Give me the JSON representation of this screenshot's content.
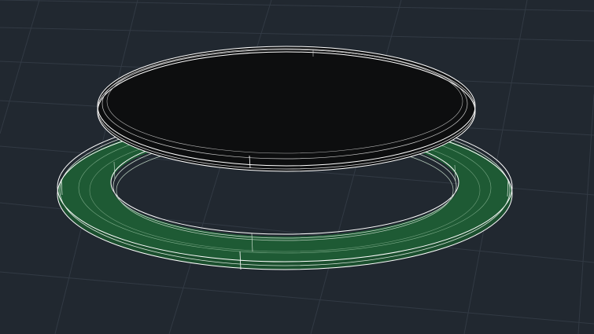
{
  "viewport": {
    "background_color": "#212830",
    "grid_color": "#323a44",
    "visual_style": "wireframe-shaded"
  },
  "objects": [
    {
      "kind": "ring",
      "name": "lower-ring",
      "fill_color": "#1e5a34",
      "edge_color": "#ffffff",
      "selected": false
    },
    {
      "kind": "disc",
      "name": "upper-disc",
      "fill_color": "#0d0e0f",
      "edge_color": "#ffffff",
      "selected": false
    }
  ]
}
